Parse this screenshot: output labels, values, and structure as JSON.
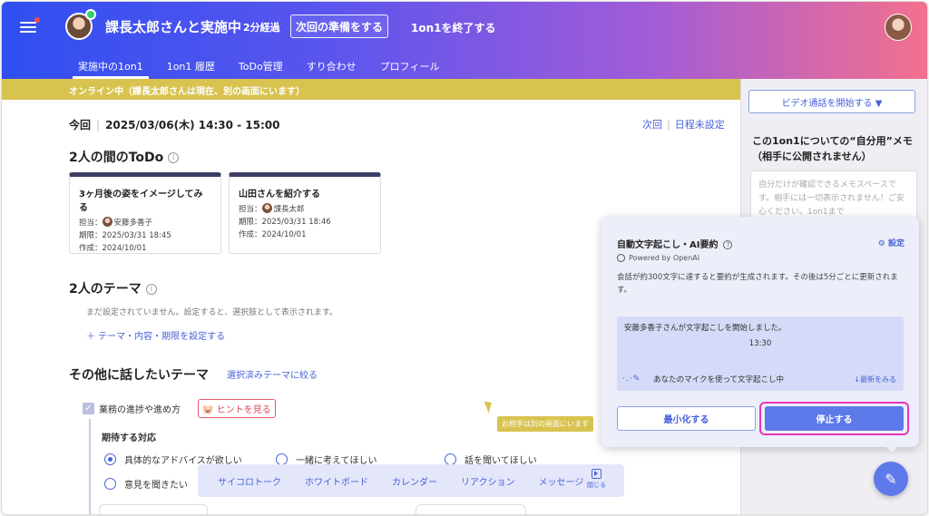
{
  "header": {
    "session_title": "課長太郎さんと実施中",
    "elapsed": "2分経過",
    "prep_button": "次回の準備をする",
    "end_link": "1on1を終了する"
  },
  "nav": {
    "tabs": [
      {
        "label": "実施中の1on1",
        "active": true
      },
      {
        "label": "1on1 履歴"
      },
      {
        "label": "ToDo管理"
      },
      {
        "label": "すり合わせ"
      },
      {
        "label": "プロフィール"
      }
    ]
  },
  "banner": "オンライン中（課長太郎さんは現在、別の画面にいます）",
  "schedule": {
    "current_label": "今回",
    "current_datetime": "2025/03/06(木) 14:30 - 15:00",
    "next_label": "次回",
    "next_value": "日程未設定"
  },
  "todo": {
    "title": "2人の間のToDo",
    "cards": [
      {
        "title": "3ヶ月後の姿をイメージしてみる",
        "assignee": "担当：安藤多香子",
        "due": "期限：2025/03/31 18:45",
        "created": "作成：2024/10/01"
      },
      {
        "title": "山田さんを紹介する",
        "assignee": "担当：課長太郎",
        "due": "期限：2025/03/31 18:46",
        "created": "作成：2024/10/01"
      }
    ]
  },
  "theme": {
    "title": "2人のテーマ",
    "empty": "まだ設定されていません。設定すると、選択肢として表示されます。",
    "add_link": "＋  テーマ・内容・期限を設定する"
  },
  "other": {
    "title": "その他に話したいテーマ",
    "filter_link": "選択済みテーマに絞る",
    "check_label": "業務の進捗や進め方",
    "hint_button": "🐷 ヒントを見る",
    "expect_label": "期待する対応",
    "options": [
      {
        "label": "具体的なアドバイスが欲しい",
        "selected": true
      },
      {
        "label": "一緒に考えてほしい",
        "selected": false
      },
      {
        "label": "話を聞いてほしい",
        "selected": false
      },
      {
        "label": "意見を聞きたい",
        "selected": false
      }
    ]
  },
  "toolbar": {
    "items": [
      "サイコロトーク",
      "ホワイトボード",
      "カレンダー",
      "リアクション",
      "メッセージ"
    ],
    "close_label": "閉じる"
  },
  "cursor_tag": "お相手は別の画面にいます",
  "sidebar": {
    "video_button": "ビデオ通話を開始する ▼",
    "memo_title": "この1on1についての“自分用”メモ（相手に公開されません）",
    "memo_placeholder": "自分だけが確認できるメモスペースです。相手には一切表示されません！ご安心ください。1on1まで"
  },
  "ai_panel": {
    "title": "自動文字起こし・AI要約",
    "settings": "⚙ 設定",
    "powered": "Powered by OpenAI",
    "description": "会話が約300文字に達すると要約が生成されます。その後は5分ごとに更新されます。",
    "transcript_line": "安藤多香子さんが文字起こしを開始しました。",
    "timestamp": "13:30",
    "mic_status": "あなたのマイクを使って文字起こし中",
    "latest_link": "↓最新をみる",
    "minimize_button": "最小化する",
    "stop_button": "停止する"
  },
  "colors": {
    "accent": "#4762d8",
    "banner": "#d8c350",
    "highlight": "#ea35b9"
  }
}
